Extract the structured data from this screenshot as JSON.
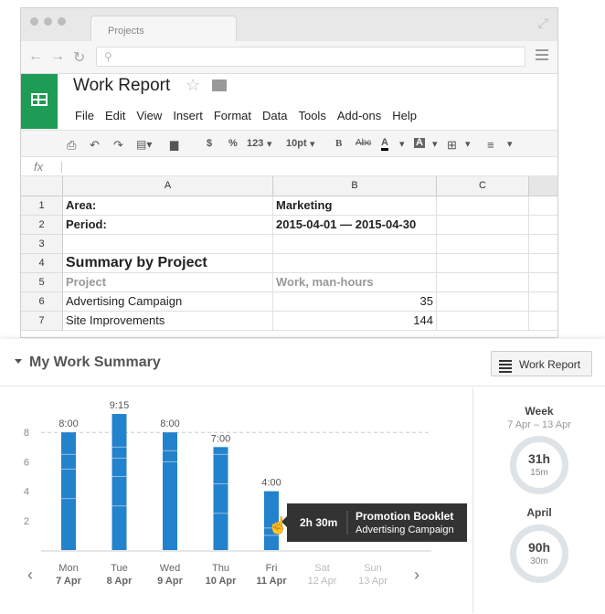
{
  "browser": {
    "tab_title": "Projects",
    "url_placeholder": ""
  },
  "doc": {
    "title": "Work Report",
    "menu": [
      "File",
      "Edit",
      "View",
      "Insert",
      "Format",
      "Data",
      "Tools",
      "Add-ons",
      "Help"
    ]
  },
  "toolbar": {
    "currency": "$",
    "percent": "%",
    "number_format": "123",
    "font_size": "10pt",
    "bold": "B",
    "strike": "Abc",
    "text_color": "A",
    "fill_color": "A"
  },
  "formula": {
    "fx": "fx"
  },
  "sheet": {
    "columns": [
      "A",
      "B",
      "C"
    ],
    "rows": [
      {
        "n": "1",
        "a": "Area:",
        "b": "Marketing",
        "style": "bold"
      },
      {
        "n": "2",
        "a": "Period:",
        "b": "2015-04-01 — 2015-04-30",
        "style": "bold"
      },
      {
        "n": "3",
        "a": "",
        "b": "",
        "style": ""
      },
      {
        "n": "4",
        "a": "Summary by Project",
        "b": "",
        "style": "big"
      },
      {
        "n": "5",
        "a": "Project",
        "b": "Work, man-hours",
        "style": "grey"
      },
      {
        "n": "6",
        "a": "Advertising Campaign",
        "b": "35",
        "style": "num"
      },
      {
        "n": "7",
        "a": "Site Improvements",
        "b": "144",
        "style": "num"
      }
    ]
  },
  "panel": {
    "title": "My Work Summary",
    "work_report_button": "Work Report"
  },
  "chart_data": {
    "type": "bar",
    "categories": [
      "Mon",
      "Tue",
      "Wed",
      "Thu",
      "Fri",
      "Sat",
      "Sun"
    ],
    "dates": [
      "7 Apr",
      "8 Apr",
      "9 Apr",
      "10 Apr",
      "11 Apr",
      "12 Apr",
      "13 Apr"
    ],
    "values": [
      8.0,
      9.25,
      8.0,
      7.0,
      4.0,
      0,
      0
    ],
    "value_labels": [
      "8:00",
      "9:15",
      "8:00",
      "7:00",
      "4:00",
      "",
      ""
    ],
    "segments": [
      [
        3.5,
        2,
        1,
        1.5
      ],
      [
        3,
        2,
        1.25,
        0.75,
        2.25
      ],
      [
        6,
        0.75,
        1.25
      ],
      [
        2.5,
        2,
        2,
        0.5
      ],
      [
        1,
        0.5,
        2.5
      ]
    ],
    "weekend": [
      false,
      false,
      false,
      false,
      false,
      true,
      true
    ],
    "ylim": [
      0,
      10
    ],
    "yticks": [
      2,
      4,
      6,
      8
    ],
    "target_line": 8,
    "bar_color": "#2382cc",
    "tooltip": {
      "duration": "2h 30m",
      "project": "Promotion Booklet",
      "client": "Advertising Campaign"
    }
  },
  "summaries": [
    {
      "title": "Week",
      "subtitle": "7 Apr – 13 Apr",
      "hours": "31h",
      "minutes": "15m"
    },
    {
      "title": "April",
      "subtitle": "",
      "hours": "90h",
      "minutes": "30m"
    }
  ],
  "colors": {
    "sheets_green": "#1e9b55",
    "bar": "#2382cc",
    "tooltip_bg": "#333333",
    "ring": "#dde3e6"
  }
}
